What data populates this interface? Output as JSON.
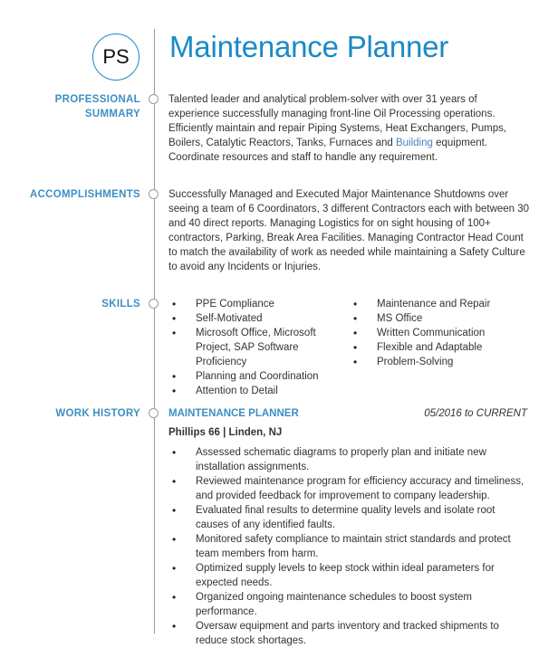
{
  "header": {
    "initials": "PS",
    "title": "Maintenance Planner"
  },
  "summary": {
    "label_line1": "PROFESSIONAL",
    "label_line2": "SUMMARY",
    "text_before_link": "Talented leader and analytical problem-solver with over 31 years of experience successfully managing front-line Oil Processing operations. Efficiently maintain and repair Piping Systems, Heat Exchangers, Pumps, Boilers, Catalytic Reactors, Tanks, Furnaces and ",
    "link_text": "Building",
    "text_after_link": " equipment. Coordinate resources and staff to handle any requirement."
  },
  "accomplishments": {
    "label": "ACCOMPLISHMENTS",
    "text": "Successfully Managed and Executed Major Maintenance Shutdowns over seeing a team of 6 Coordinators, 3 different Contractors each with between 30 and 40 direct reports. Managing Logistics for on sight housing of 100+ contractors, Parking, Break Area Facilities. Managing Contractor Head Count to match the availability of work as needed while maintaining a Safety Culture to avoid any Incidents or Injuries."
  },
  "skills": {
    "label": "SKILLS",
    "col1": [
      "PPE Compliance",
      "Self-Motivated",
      "Microsoft Office, Microsoft Project, SAP Software Proficiency",
      "Planning and Coordination",
      "Attention to Detail"
    ],
    "col2": [
      "Maintenance and Repair",
      "MS Office",
      "Written Communication",
      "Flexible and Adaptable",
      "Problem-Solving"
    ]
  },
  "work_history": {
    "label": "WORK HISTORY",
    "jobs": [
      {
        "title": "MAINTENANCE PLANNER",
        "dates": "05/2016 to CURRENT",
        "company": "Phillips 66 | Linden, NJ",
        "bullets": [
          "Assessed schematic diagrams to properly plan and initiate new installation assignments.",
          "Reviewed maintenance program for efficiency accuracy and timeliness, and provided feedback for improvement to company leadership.",
          "Evaluated final results to determine quality levels and isolate root causes of any identified faults.",
          "Monitored safety compliance to maintain strict standards and protect team members from harm.",
          "Optimized supply levels to keep stock within ideal parameters for expected needs.",
          "Organized ongoing maintenance schedules to boost system performance.",
          "Oversaw equipment and parts inventory and tracked shipments to reduce stock shortages."
        ]
      }
    ]
  }
}
